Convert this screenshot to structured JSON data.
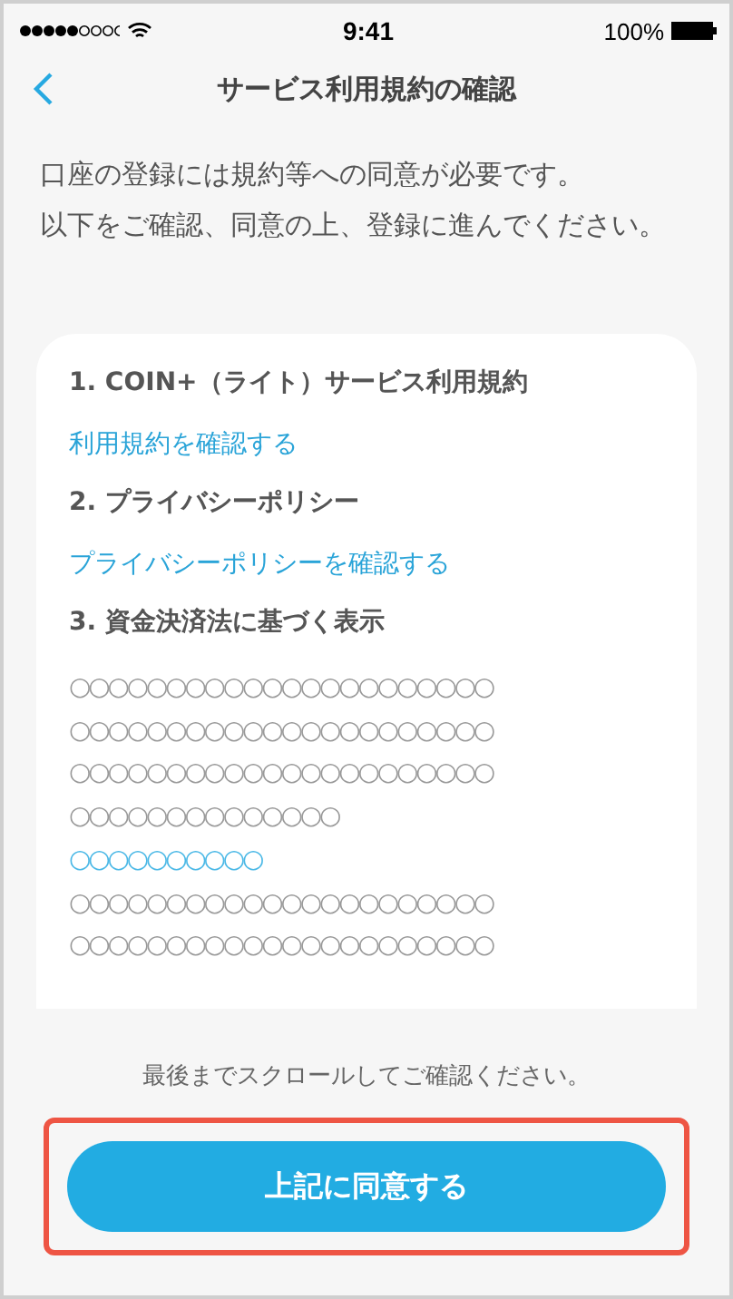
{
  "status_bar": {
    "time": "9:41",
    "battery": "100%"
  },
  "nav": {
    "title": "サービス利用規約の確認"
  },
  "intro": [
    "口座の登録には規約等への同意が必要です。",
    "以下をご確認、同意の上、登録に進んでください。"
  ],
  "sections": [
    {
      "kind": "link",
      "heading": "1. COIN+（ライト）サービス利用規約",
      "link": "利用規約を確認する"
    },
    {
      "kind": "link",
      "heading": "2. プライバシーポリシー",
      "link": "プライバシーポリシーを確認する"
    },
    {
      "kind": "text",
      "heading": "3. 資金決済法に基づく表示",
      "lines": [
        {
          "text": "○○○○○○○○○○○○○○○○○○○○○○",
          "link": false
        },
        {
          "text": "○○○○○○○○○○○○○○○○○○○○○○",
          "link": false
        },
        {
          "text": "○○○○○○○○○○○○○○○○○○○○○○",
          "link": false
        },
        {
          "text": "○○○○○○○○○○○○○○",
          "link": false
        },
        {
          "text": "○○○○○○○○○○",
          "link": true
        },
        {
          "text": "○○○○○○○○○○○○○○○○○○○○○○",
          "link": false
        },
        {
          "text": "○○○○○○○○○○○○○○○○○○○○○○",
          "link": false
        }
      ]
    }
  ],
  "footer_note": "最後までスクロールしてご確認ください。",
  "agree_button": {
    "label": "上記に同意する",
    "highlighted": true
  }
}
